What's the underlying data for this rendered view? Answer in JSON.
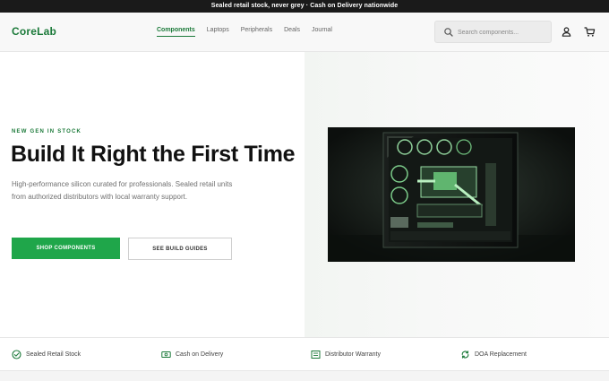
{
  "announcement": "Sealed retail stock, never grey · Cash on Delivery nationwide",
  "header": {
    "logo": "CoreLab",
    "nav": [
      "Components",
      "Laptops",
      "Peripherals",
      "Deals",
      "Journal"
    ],
    "active_nav": "Components",
    "search_placeholder": "Search components...",
    "icons": [
      "search-icon",
      "account-icon",
      "cart-icon"
    ]
  },
  "hero": {
    "eyebrow": "NEW GEN IN STOCK",
    "headline": "Build It Right the First Time",
    "lead": "High-performance silicon curated for professionals. Sealed retail units from authorized distributors with local warranty support.",
    "primary_cta": "SHOP COMPONENTS",
    "secondary_cta": "SEE BUILD GUIDES",
    "image": "pc-build-photo"
  },
  "features": [
    {
      "label": "Sealed Retail Stock",
      "icon": "check-circle-icon"
    },
    {
      "label": "Cash on Delivery",
      "icon": "cash-icon"
    },
    {
      "label": "Distributor Warranty",
      "icon": "warranty-icon"
    },
    {
      "label": "DOA Replacement",
      "icon": "replacement-icon"
    }
  ],
  "colors": {
    "brand": "#1c7a3a",
    "primary_button": "#1fa64a",
    "announcement_bg": "#1a1a1a"
  }
}
